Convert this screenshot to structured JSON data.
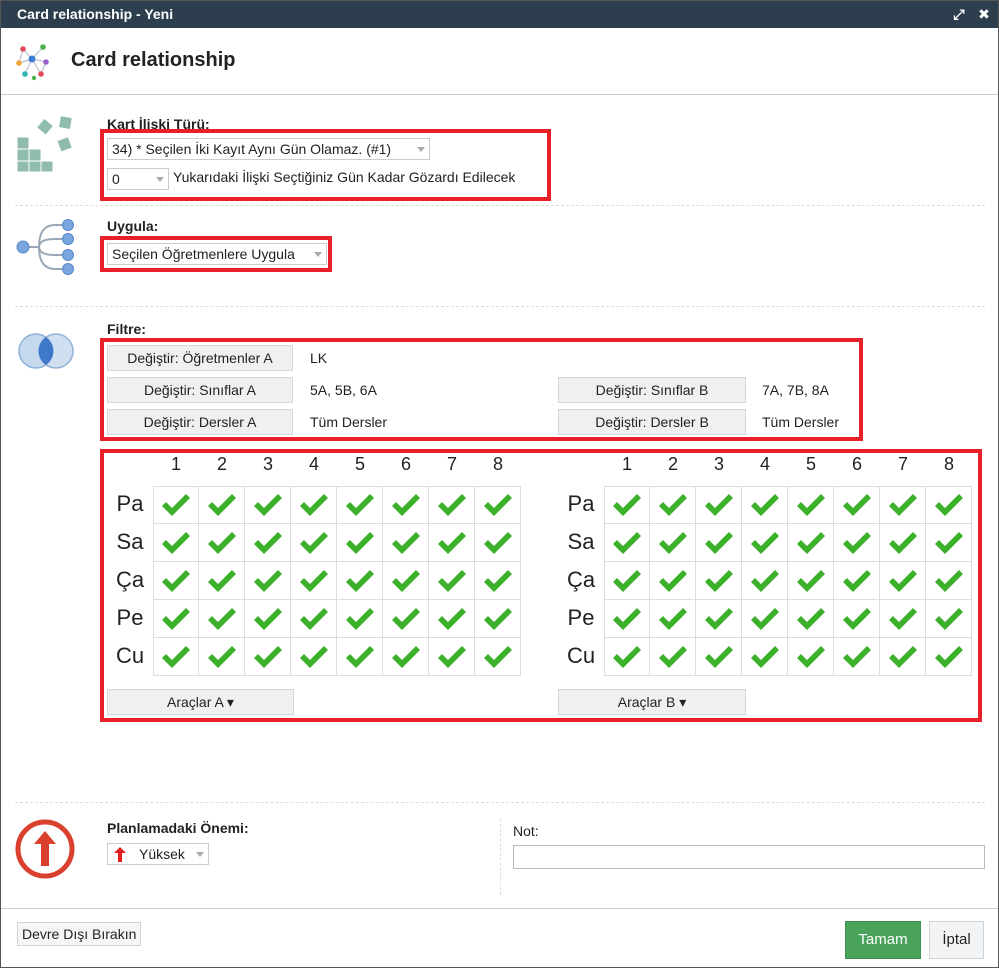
{
  "window": {
    "title": "Card relationship - Yeni",
    "maximize_glyph": "⤢",
    "close_glyph": "✖"
  },
  "header": {
    "title": "Card relationship",
    "icon": "network-graph-icon"
  },
  "card_type": {
    "label": "Kart İlişki Türü:",
    "icon": "cards-icon",
    "relation_value": "34) * Seçilen İki Kayıt Aynı Gün Olamaz. (#1)",
    "ignore_days_value": "0",
    "ignore_days_text": "Yukarıdaki İlişki Seçtiğiniz Gün Kadar Gözardı Edilecek"
  },
  "apply": {
    "label": "Uygula:",
    "icon": "tree-branch-icon",
    "value": "Seçilen Öğretmenlere Uygula"
  },
  "filter": {
    "label": "Filtre:",
    "icon": "venn-icon",
    "teachers_a": {
      "button": "Değiştir: Öğretmenler A",
      "value": "LK"
    },
    "classes_a": {
      "button": "Değiştir: Sınıflar A",
      "value": "5A, 5B, 6A"
    },
    "classes_b": {
      "button": "Değiştir: Sınıflar B",
      "value": "7A, 7B, 8A"
    },
    "subjects_a": {
      "button": "Değiştir: Dersler A",
      "value": "Tüm Dersler"
    },
    "subjects_b": {
      "button": "Değiştir: Dersler B",
      "value": "Tüm Dersler"
    }
  },
  "grids": {
    "columns": [
      "1",
      "2",
      "3",
      "4",
      "5",
      "6",
      "7",
      "8"
    ],
    "rows": [
      "Pa",
      "Sa",
      "Ça",
      "Pe",
      "Cu"
    ],
    "check_color": "#3cb02a",
    "a": {
      "tools_label": "Araçlar A ▾"
    },
    "b": {
      "tools_label": "Araçlar B ▾"
    }
  },
  "importance": {
    "label": "Planlamadaki Önemi:",
    "icon": "arrow-up-circle-icon",
    "value": "Yüksek",
    "value_icon": "red-arrow-up-icon",
    "accent": "#d9412e"
  },
  "note": {
    "label": "Not:",
    "value": ""
  },
  "footer": {
    "disable_label": "Devre Dışı Bırakın",
    "ok_label": "Tamam",
    "cancel_label": "İptal"
  },
  "colors": {
    "titlebar": "#2d3e4e",
    "highlight": "#e8202a",
    "ok_button": "#4aa35a"
  }
}
